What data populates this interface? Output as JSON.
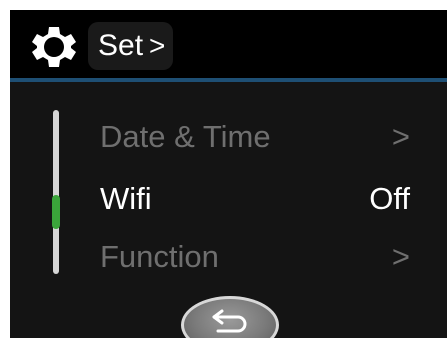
{
  "header": {
    "icon": "gear-icon",
    "title": "Set",
    "title_chevron": ">"
  },
  "menu": {
    "items": [
      {
        "label": "Date & Time",
        "value": ">",
        "state": "dimmed"
      },
      {
        "label": "Wifi",
        "value": "Off",
        "state": "selected"
      },
      {
        "label": "Function",
        "value": ">",
        "state": "dimmed"
      }
    ]
  },
  "scrollbar": {
    "position_fraction": 0.6
  },
  "footer": {
    "back_icon": "return-arrow-icon"
  },
  "colors": {
    "background": "#141414",
    "header_bg": "#000000",
    "divider": "#1e4f74",
    "selected_text": "#ffffff",
    "dimmed_text": "#6f6f6f",
    "scroll_thumb": "#3aa43a"
  }
}
